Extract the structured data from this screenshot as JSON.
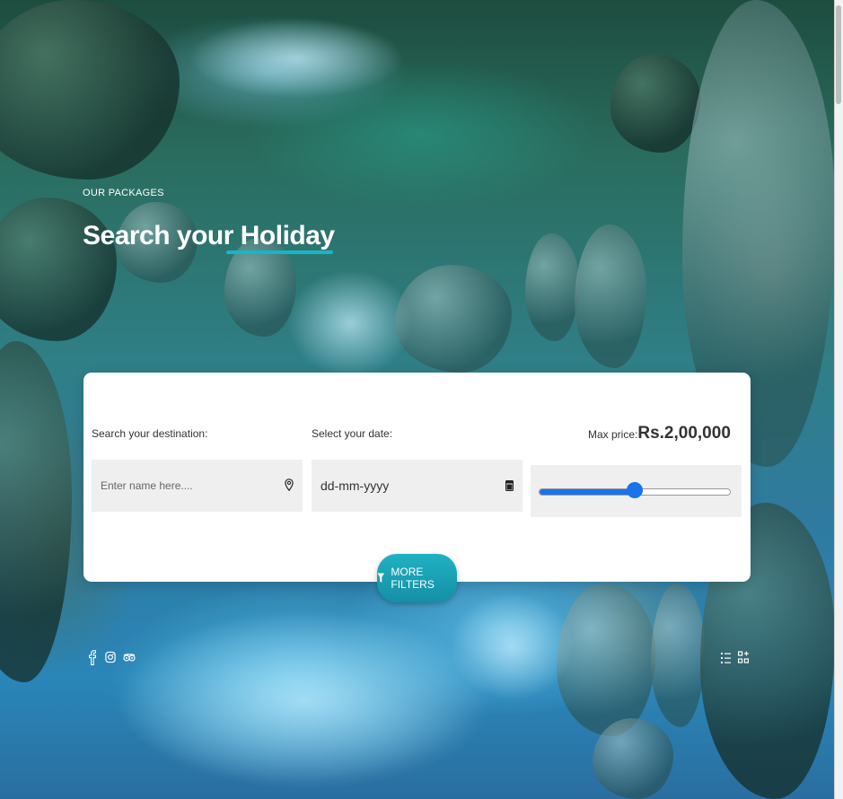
{
  "hero": {
    "eyebrow": "OUR PACKAGES",
    "title_main": "Search your ",
    "title_accent": "Holiday"
  },
  "search": {
    "destination_label": "Search your destination:",
    "destination_placeholder": "Enter name here....",
    "destination_icon": "location-pin-icon",
    "date_label": "Select your date:",
    "date_value": "dd-mm-yyyy",
    "date_icon": "calendar-icon",
    "price_label": "Max price:",
    "price_value": "Rs.2,00,000",
    "price_slider_fraction": 0.5
  },
  "filters_button": {
    "label": "MORE FILTERS",
    "icon": "funnel-icon"
  },
  "social_icons": [
    "facebook-icon",
    "instagram-icon",
    "tripadvisor-icon"
  ],
  "view_icons": [
    "list-view-icon",
    "grid-view-icon"
  ],
  "colors": {
    "accent": "#17b6c7",
    "slider": "#1a73e8",
    "card": "#ffffff",
    "input_bg": "#efefef"
  }
}
